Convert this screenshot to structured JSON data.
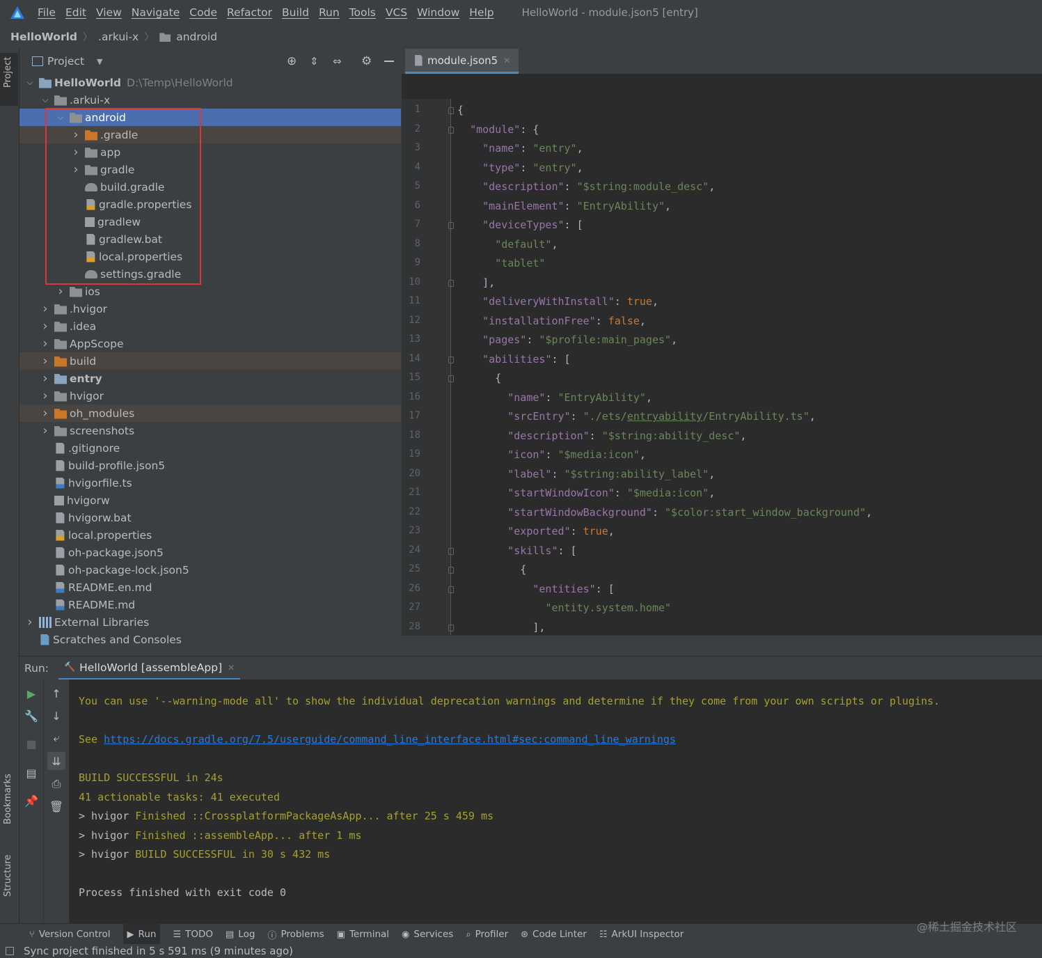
{
  "menubar": {
    "items": [
      "File",
      "Edit",
      "View",
      "Navigate",
      "Code",
      "Refactor",
      "Build",
      "Run",
      "Tools",
      "VCS",
      "Window",
      "Help"
    ],
    "window_title": "HelloWorld - module.json5 [entry]"
  },
  "breadcrumb": [
    "HelloWorld",
    ".arkui-x",
    "android"
  ],
  "side_tabs": {
    "project": "Project",
    "bookmarks": "Bookmarks",
    "structure": "Structure"
  },
  "project_panel": {
    "title": "Project",
    "tree": [
      {
        "label": "HelloWorld",
        "path": "D:\\Temp\\HelloWorld",
        "expanded": true,
        "icon": "module-folder-icon"
      },
      {
        "label": ".arkui-x",
        "expanded": true,
        "icon": "folder-icon"
      },
      {
        "label": "android",
        "expanded": true,
        "icon": "folder-icon",
        "selected": true
      },
      {
        "label": ".gradle",
        "expanded": false,
        "icon": "excluded-folder-icon"
      },
      {
        "label": "app",
        "expanded": false,
        "icon": "folder-icon"
      },
      {
        "label": "gradle",
        "expanded": false,
        "icon": "folder-icon"
      },
      {
        "label": "build.gradle",
        "icon": "gradle-icon"
      },
      {
        "label": "gradle.properties",
        "icon": "properties-icon"
      },
      {
        "label": "gradlew",
        "icon": "shell-icon"
      },
      {
        "label": "gradlew.bat",
        "icon": "bat-icon"
      },
      {
        "label": "local.properties",
        "icon": "properties-icon"
      },
      {
        "label": "settings.gradle",
        "icon": "gradle-icon"
      },
      {
        "label": "ios",
        "expanded": false,
        "icon": "folder-icon"
      },
      {
        "label": ".hvigor",
        "expanded": false,
        "icon": "folder-icon"
      },
      {
        "label": ".idea",
        "expanded": false,
        "icon": "folder-icon"
      },
      {
        "label": "AppScope",
        "expanded": false,
        "icon": "folder-icon"
      },
      {
        "label": "build",
        "expanded": false,
        "icon": "excluded-folder-icon"
      },
      {
        "label": "entry",
        "expanded": false,
        "icon": "module-folder-icon"
      },
      {
        "label": "hvigor",
        "expanded": false,
        "icon": "folder-icon"
      },
      {
        "label": "oh_modules",
        "expanded": false,
        "icon": "excluded-folder-icon"
      },
      {
        "label": "screenshots",
        "expanded": false,
        "icon": "folder-icon"
      },
      {
        "label": ".gitignore",
        "icon": "file-icon"
      },
      {
        "label": "build-profile.json5",
        "icon": "json-icon"
      },
      {
        "label": "hvigorfile.ts",
        "icon": "ts-icon"
      },
      {
        "label": "hvigorw",
        "icon": "shell-icon"
      },
      {
        "label": "hvigorw.bat",
        "icon": "bat-icon"
      },
      {
        "label": "local.properties",
        "icon": "properties-icon"
      },
      {
        "label": "oh-package.json5",
        "icon": "json-icon"
      },
      {
        "label": "oh-package-lock.json5",
        "icon": "json-icon"
      },
      {
        "label": "README.en.md",
        "icon": "markdown-icon"
      },
      {
        "label": "README.md",
        "icon": "markdown-icon"
      },
      {
        "label": "External Libraries",
        "expanded": false,
        "icon": "libraries-icon"
      },
      {
        "label": "Scratches and Consoles",
        "icon": "scratches-icon"
      }
    ]
  },
  "editor": {
    "tab": "module.json5",
    "lines": [
      "{",
      "  \"module\": {",
      "    \"name\": \"entry\",",
      "    \"type\": \"entry\",",
      "    \"description\": \"$string:module_desc\",",
      "    \"mainElement\": \"EntryAbility\",",
      "    \"deviceTypes\": [",
      "      \"default\",",
      "      \"tablet\"",
      "    ],",
      "    \"deliveryWithInstall\": true,",
      "    \"installationFree\": false,",
      "    \"pages\": \"$profile:main_pages\",",
      "    \"abilities\": [",
      "      {",
      "        \"name\": \"EntryAbility\",",
      "        \"srcEntry\": \"./ets/entryability/EntryAbility.ts\",",
      "        \"description\": \"$string:ability_desc\",",
      "        \"icon\": \"$media:icon\",",
      "        \"label\": \"$string:ability_label\",",
      "        \"startWindowIcon\": \"$media:icon\",",
      "        \"startWindowBackground\": \"$color:start_window_background\",",
      "        \"exported\": true,",
      "        \"skills\": [",
      "          {",
      "            \"entities\": [",
      "              \"entity.system.home\"",
      "            ],"
    ]
  },
  "run_panel": {
    "label": "Run:",
    "tab": "HelloWorld [assembleApp]",
    "console": [
      {
        "text": "You can use '--warning-mode all' to show the individual deprecation warnings and determine if they come from your own scripts or plugins.",
        "color": "#a5a12f"
      },
      {
        "text": "",
        "color": "#a5a12f"
      },
      {
        "prefix": "See ",
        "link": "https://docs.gradle.org/7.5/userguide/command_line_interface.html#sec:command_line_warnings",
        "color": "#a5a12f"
      },
      {
        "text": "",
        "color": "#a5a12f"
      },
      {
        "text": "BUILD SUCCESSFUL in 24s",
        "color": "#a5a12f"
      },
      {
        "text": "41 actionable tasks: 41 executed",
        "color": "#a5a12f"
      },
      {
        "prefix": "> hvigor ",
        "text": "Finished ::CrossplatformPackageAsApp... after 25 s 459 ms",
        "color": "#a5a12f"
      },
      {
        "prefix": "> hvigor ",
        "text": "Finished ::assembleApp... after 1 ms",
        "color": "#a5a12f"
      },
      {
        "prefix": "> hvigor ",
        "text": "BUILD SUCCESSFUL in 30 s 432 ms",
        "color": "#a5a12f"
      },
      {
        "text": "",
        "color": "#a5a12f"
      },
      {
        "text": "Process finished with exit code 0",
        "color": "#bbbbbb"
      }
    ]
  },
  "tool_windows": [
    "Version Control",
    "Run",
    "TODO",
    "Log",
    "Problems",
    "Terminal",
    "Services",
    "Profiler",
    "Code Linter",
    "ArkUI Inspector"
  ],
  "status": "Sync project finished in 5 s 591 ms (9 minutes ago)",
  "watermark": "@稀土掘金技术社区",
  "colors": {
    "selection": "#4b6eaf",
    "highlight_box": "#e0343c",
    "console_text": "#a5a12f",
    "link": "#287bde"
  }
}
